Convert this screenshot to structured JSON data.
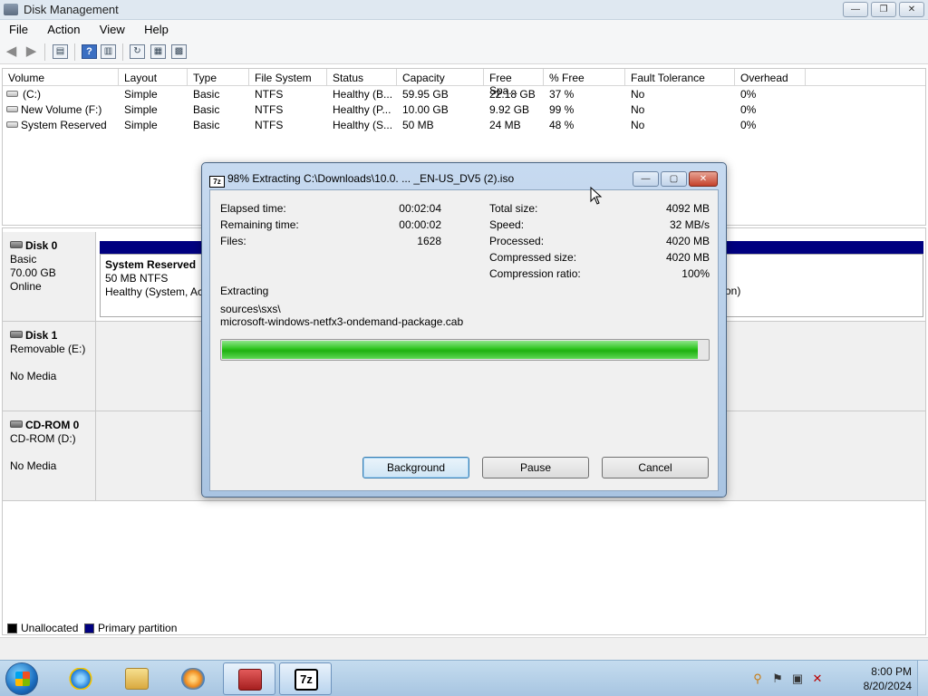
{
  "window": {
    "title": "Disk Management",
    "controls": [
      "—",
      "❐",
      "✕"
    ]
  },
  "menu": [
    "File",
    "Action",
    "View",
    "Help"
  ],
  "volumes": {
    "headers": [
      "Volume",
      "Layout",
      "Type",
      "File System",
      "Status",
      "Capacity",
      "Free Spa...",
      "% Free",
      "Fault Tolerance",
      "Overhead"
    ],
    "rows": [
      [
        "(C:)",
        "Simple",
        "Basic",
        "NTFS",
        "Healthy (B...",
        "59.95 GB",
        "22.18 GB",
        "37 %",
        "No",
        "0%"
      ],
      [
        "New Volume (F:)",
        "Simple",
        "Basic",
        "NTFS",
        "Healthy (P...",
        "10.00 GB",
        "9.92 GB",
        "99 %",
        "No",
        "0%"
      ],
      [
        "System Reserved",
        "Simple",
        "Basic",
        "NTFS",
        "Healthy (S...",
        "50 MB",
        "24 MB",
        "48 %",
        "No",
        "0%"
      ]
    ]
  },
  "disks": [
    {
      "name": "Disk 0",
      "lines": [
        "Basic",
        "70.00 GB",
        "Online"
      ],
      "partition": {
        "name": "System Reserved",
        "size": "50 MB NTFS",
        "status": "Healthy (System, Act"
      },
      "partition_tail": "on)"
    },
    {
      "name": "Disk 1",
      "lines": [
        "Removable (E:)",
        "",
        "No Media"
      ]
    },
    {
      "name": "CD-ROM 0",
      "lines": [
        "CD-ROM (D:)",
        "",
        "No Media"
      ]
    }
  ],
  "legend": [
    {
      "label": "Unallocated",
      "color": "#000000"
    },
    {
      "label": "Primary partition",
      "color": "#000080"
    }
  ],
  "dialog": {
    "icon_text": "7z",
    "title": "98% Extracting C:\\Downloads\\10.0. ... _EN-US_DV5 (2).iso",
    "left": [
      {
        "label": "Elapsed time:",
        "value": "00:02:04"
      },
      {
        "label": "Remaining time:",
        "value": "00:00:02"
      },
      {
        "label": "Files:",
        "value": "1628"
      }
    ],
    "right": [
      {
        "label": "Total size:",
        "value": "4092 MB"
      },
      {
        "label": "Speed:",
        "value": "32 MB/s"
      },
      {
        "label": "Processed:",
        "value": "4020 MB"
      },
      {
        "label": "Compressed size:",
        "value": "4020 MB"
      },
      {
        "label": "Compression ratio:",
        "value": "100%"
      }
    ],
    "operation": "Extracting",
    "path_line1": "sources\\sxs\\",
    "path_line2": "microsoft-windows-netfx3-ondemand-package.cab",
    "progress": 0.98,
    "buttons": [
      "Background",
      "Pause",
      "Cancel"
    ]
  },
  "taskbar": {
    "clock_time": "8:00 PM",
    "clock_date": "8/20/2024",
    "apps": [
      "internet-explorer",
      "windows-explorer",
      "media-player",
      "computer-management",
      "7-zip"
    ]
  }
}
